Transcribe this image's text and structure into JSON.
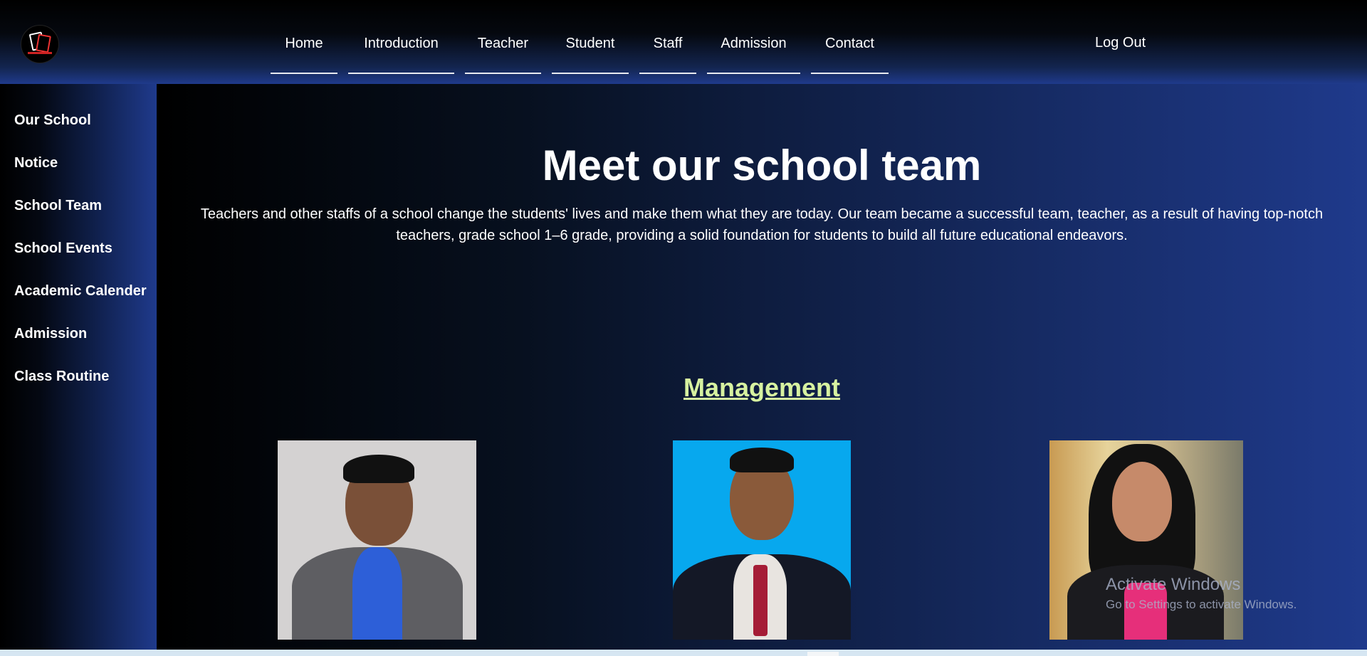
{
  "nav": {
    "items": [
      "Home",
      "Introduction",
      "Teacher",
      "Student",
      "Staff",
      "Admission",
      "Contact"
    ],
    "logout": "Log Out"
  },
  "sidebar": {
    "items": [
      "Our School",
      "Notice",
      "School Team",
      "School Events",
      "Academic Calender",
      "Admission",
      "Class Routine"
    ]
  },
  "main": {
    "title": "Meet our school team",
    "intro": "Teachers and other staffs of a school change the students' lives and make them what they are today. Our team became a successful team, teacher, as a result of having top-notch teachers, grade school 1–6 grade, providing a solid foundation for students to build all future educational endeavors.",
    "section_title": "Management"
  },
  "watermark": {
    "line1": "Activate Windows",
    "line2": "Go to Settings to activate Windows."
  }
}
